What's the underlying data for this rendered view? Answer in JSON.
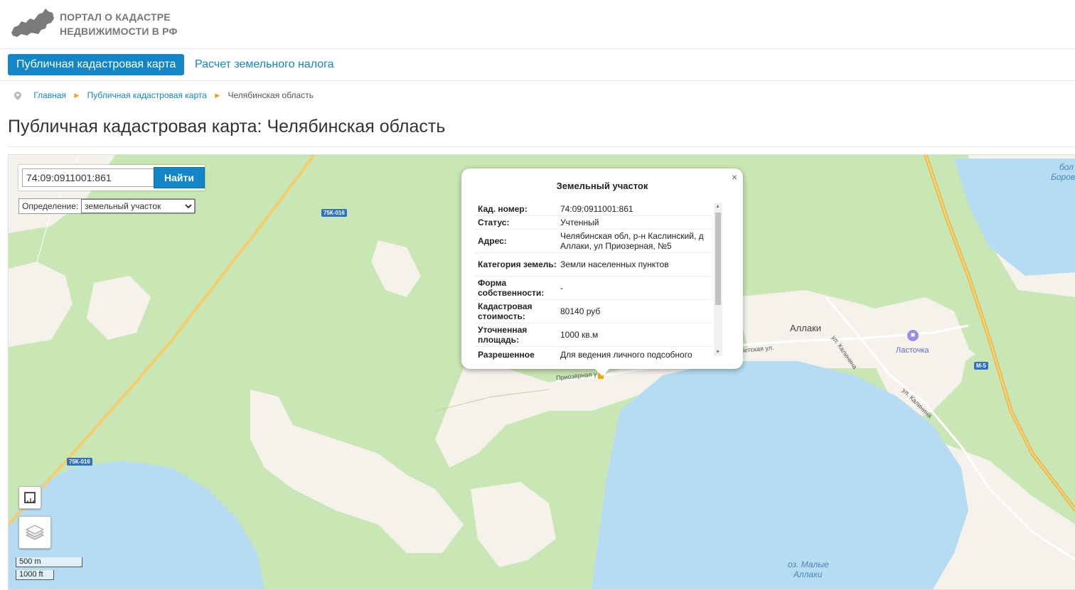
{
  "header": {
    "logo_line1": "ПОРТАЛ О КАДАСТРЕ",
    "logo_line2": "НЕДВИЖИМОСТИ В РФ"
  },
  "nav": {
    "tabs": [
      {
        "label": "Публичная кадастровая карта",
        "active": true
      },
      {
        "label": "Расчет земельного налога",
        "active": false
      }
    ]
  },
  "breadcrumb": {
    "items": [
      "Главная",
      "Публичная кадастровая карта",
      "Челябинская область"
    ]
  },
  "page": {
    "title": "Публичная кадастровая карта: Челябинская область"
  },
  "map": {
    "search": {
      "value": "74:09:0911001:861",
      "button": "Найти"
    },
    "definition": {
      "label": "Определение:",
      "selected": "земельный участок"
    },
    "labels": {
      "road1": "75К-016",
      "road2": "75К-016",
      "road3": "М-5",
      "village": "Аллаки",
      "hotel": "Ласточка",
      "lake": "оз. Малые",
      "lake2": "Аллаки",
      "corner1": "бол",
      "corner2": "Боров",
      "street1": "ул. Калинина",
      "street2": "ул. Калинина",
      "street3": "ветская ул.",
      "street4": "Приозёрная у"
    },
    "scale": {
      "metric": "500 m",
      "imperial": "1000 ft"
    },
    "colors": {
      "forest": "#c9e7b4",
      "clearing": "#f4f2ea",
      "water": "#b5dcf3",
      "road": "#f5cd6a",
      "accent": "#1286c7"
    }
  },
  "popup": {
    "title": "Земельный участок",
    "close": "×",
    "rows": [
      {
        "key": "Кад. номер:",
        "value": "74:09:0911001:861"
      },
      {
        "key": "Статус:",
        "value": "Учтенный"
      },
      {
        "key": "Адрес:",
        "value": "Челябинская обл, р-н Каслинский, д Аллаки, ул Приозерная, №5"
      },
      {
        "key": "Категория земель:",
        "value": "Земли населенных пунктов"
      },
      {
        "key": "Форма собственности:",
        "value": "-"
      },
      {
        "key": "Кадастровая стоимость:",
        "value": "80140 руб"
      },
      {
        "key": "Уточненная площадь:",
        "value": "1000 кв.м"
      },
      {
        "key": "Разрешенное",
        "value": "Для ведения личного подсобного"
      }
    ]
  }
}
